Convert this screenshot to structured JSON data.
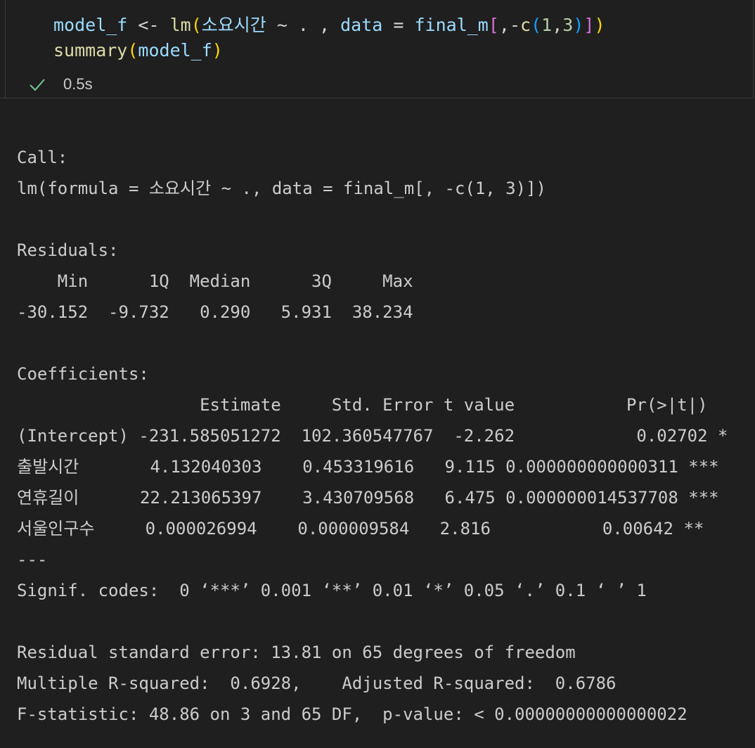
{
  "cell": {
    "code": {
      "line1": {
        "t1": "model_f",
        "t2": " <- ",
        "t3": "lm",
        "t4": "(",
        "t5": "소요시간",
        "t6": " ~ . , ",
        "t7": "data",
        "t8": " = ",
        "t9": "final_m",
        "t10": "[",
        "t11": ",-",
        "t12": "c",
        "t13": "(",
        "t14": "1",
        "t15": ",",
        "t16": "3",
        "t17": ")",
        "t18": "]",
        "t19": ")"
      },
      "line2": {
        "t1": "summary",
        "t2": "(",
        "t3": "model_f",
        "t4": ")"
      }
    },
    "status": {
      "icon": "check-icon",
      "exec_time": "0.5s"
    }
  },
  "output": {
    "text": "Call:\nlm(formula = 소요시간 ~ ., data = final_m[, -c(1, 3)])\n\nResiduals:\n    Min      1Q  Median      3Q     Max \n-30.152  -9.732   0.290   5.931  38.234 \n\nCoefficients:\n                  Estimate     Std. Error t value           Pr(>|t|)    \n(Intercept) -231.585051272  102.360547767  -2.262            0.02702 *  \n출발시간       4.132040303    0.453319616   9.115 0.000000000000311 ***\n연휴길이      22.213065397    3.430709568   6.475 0.000000014537708 ***\n서울인구수     0.000026994    0.000009584   2.816           0.00642 ** \n---\nSignif. codes:  0 ‘***’ 0.001 ‘**’ 0.01 ‘*’ 0.05 ‘.’ 0.1 ‘ ’ 1\n\nResidual standard error: 13.81 on 65 degrees of freedom\nMultiple R-squared:  0.6928,\tAdjusted R-squared:  0.6786 \nF-statistic: 48.86 on 3 and 65 DF,  p-value: < 0.00000000000000022"
  },
  "colors": {
    "background": "#1f1f1f",
    "check": "#73c991",
    "output_text": "#cccccc"
  }
}
